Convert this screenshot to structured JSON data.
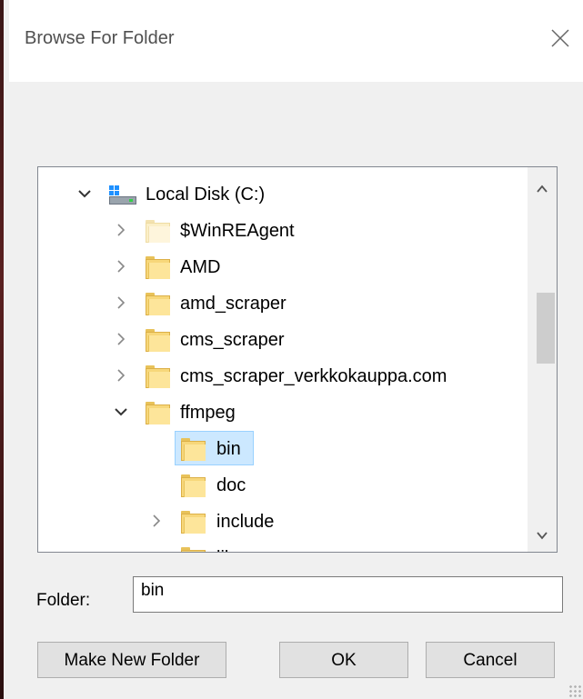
{
  "dialog": {
    "title": "Browse For Folder",
    "close_icon": "close-icon"
  },
  "tree": {
    "root": {
      "label": "Local Disk (C:)",
      "icon": "drive-icon",
      "expanded": true
    },
    "items": [
      {
        "label": "$WinREAgent",
        "expanded": false,
        "has_children": true,
        "hidden_folder": true
      },
      {
        "label": "AMD",
        "expanded": false,
        "has_children": true
      },
      {
        "label": "amd_scraper",
        "expanded": false,
        "has_children": true
      },
      {
        "label": "cms_scraper",
        "expanded": false,
        "has_children": true
      },
      {
        "label": "cms_scraper_verkkokauppa.com",
        "expanded": false,
        "has_children": true
      },
      {
        "label": "ffmpeg",
        "expanded": true,
        "has_children": true
      },
      {
        "label": "bin",
        "selected": true,
        "has_children": false
      },
      {
        "label": "doc",
        "has_children": false
      },
      {
        "label": "include",
        "expanded": false,
        "has_children": true
      },
      {
        "label": "lib",
        "has_children": false
      }
    ]
  },
  "folder_field": {
    "label": "Folder:",
    "value": "bin"
  },
  "buttons": {
    "make_new_folder": "Make New Folder",
    "ok": "OK",
    "cancel": "Cancel"
  },
  "colors": {
    "selection_bg": "#cce8ff",
    "selection_border": "#99d1ff",
    "folder_yellow": "#f7d77a"
  }
}
